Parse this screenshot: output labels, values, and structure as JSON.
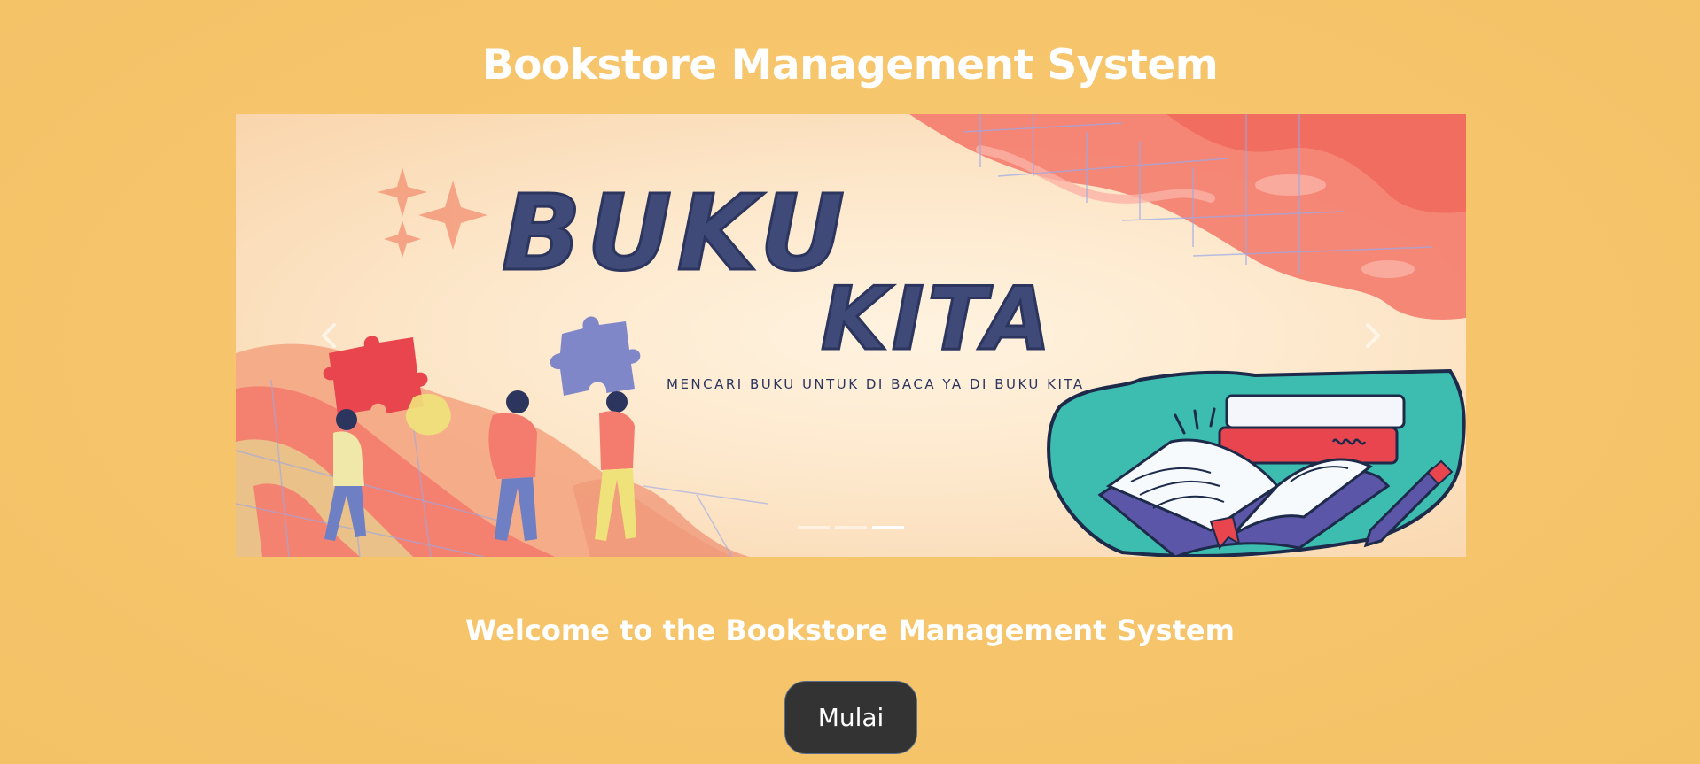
{
  "header": {
    "title": "Bookstore Management System"
  },
  "carousel": {
    "banner": {
      "headline_1": "BUKU",
      "headline_2": "KITA",
      "tagline": "MENCARI BUKU UNTUK DI BACA YA DI BUKU KITA"
    },
    "prev_icon": "chevron-left-icon",
    "next_icon": "chevron-right-icon",
    "slide_count": 3,
    "active_slide": 3
  },
  "main": {
    "welcome_text": "Welcome to the Bookstore Management System",
    "start_button_label": "Mulai"
  },
  "colors": {
    "background": "#f6c56b",
    "title_text": "#ffffff",
    "button_bg": "#333333",
    "banner_text": "#3f4a78",
    "coral": "#f47c6e",
    "teal": "#3dbcb0"
  }
}
